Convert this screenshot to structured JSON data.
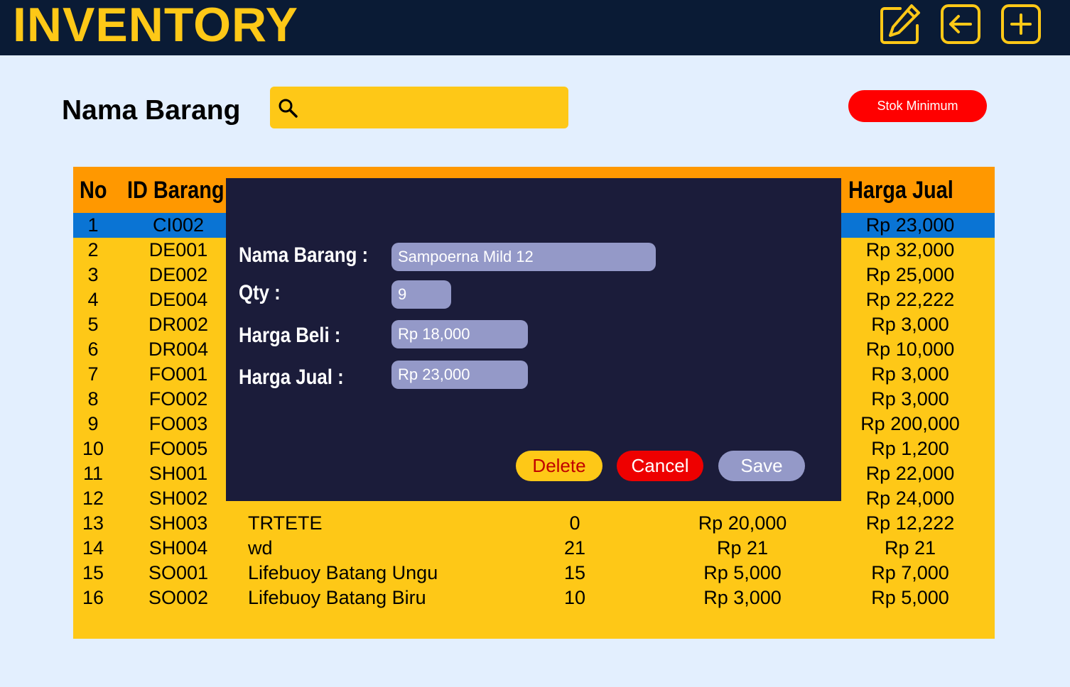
{
  "header": {
    "title": "INVENTORY",
    "edit_icon": "edit-icon",
    "back_icon": "back-arrow-icon",
    "add_icon": "plus-icon"
  },
  "search": {
    "label": "Nama Barang",
    "value": "",
    "icon": "search-icon"
  },
  "stok_minimum_label": "Stok Minimum",
  "colors": {
    "topbar": "#0a1b35",
    "accent_yellow": "#fec817",
    "table_header": "#ff9800",
    "selected_row": "#0a74d4",
    "danger": "#ff0000",
    "modal_bg": "#1b1c3a",
    "modal_input": "#9499c8",
    "page_bg": "#e3effe"
  },
  "table": {
    "headers": {
      "no": "No",
      "id": "ID Barang",
      "jual": "Harga Jual"
    },
    "selected_row": 0,
    "rows": [
      {
        "no": "1",
        "id": "CI002",
        "nama": "",
        "qty": "",
        "beli": "",
        "jual": "Rp 23,000"
      },
      {
        "no": "2",
        "id": "DE001",
        "nama": "",
        "qty": "",
        "beli": "",
        "jual": "Rp 32,000"
      },
      {
        "no": "3",
        "id": "DE002",
        "nama": "",
        "qty": "",
        "beli": "",
        "jual": "Rp 25,000"
      },
      {
        "no": "4",
        "id": "DE004",
        "nama": "",
        "qty": "",
        "beli": "",
        "jual": "Rp 22,222"
      },
      {
        "no": "5",
        "id": "DR002",
        "nama": "",
        "qty": "",
        "beli": "",
        "jual": "Rp 3,000"
      },
      {
        "no": "6",
        "id": "DR004",
        "nama": "",
        "qty": "",
        "beli": "",
        "jual": "Rp 10,000"
      },
      {
        "no": "7",
        "id": "FO001",
        "nama": "",
        "qty": "",
        "beli": "",
        "jual": "Rp 3,000"
      },
      {
        "no": "8",
        "id": "FO002",
        "nama": "",
        "qty": "",
        "beli": "",
        "jual": "Rp 3,000"
      },
      {
        "no": "9",
        "id": "FO003",
        "nama": "",
        "qty": "",
        "beli": "",
        "jual": "Rp 200,000"
      },
      {
        "no": "10",
        "id": "FO005",
        "nama": "",
        "qty": "",
        "beli": "",
        "jual": "Rp 1,200"
      },
      {
        "no": "11",
        "id": "SH001",
        "nama": "",
        "qty": "",
        "beli": "",
        "jual": "Rp 22,000"
      },
      {
        "no": "12",
        "id": "SH002",
        "nama": "",
        "qty": "",
        "beli": "",
        "jual": "Rp 24,000"
      },
      {
        "no": "13",
        "id": "SH003",
        "nama": "TRTETE",
        "qty": "0",
        "beli": "Rp 20,000",
        "jual": "Rp 12,222"
      },
      {
        "no": "14",
        "id": "SH004",
        "nama": "wd",
        "qty": "21",
        "beli": "Rp 21",
        "jual": "Rp 21"
      },
      {
        "no": "15",
        "id": "SO001",
        "nama": "Lifebuoy Batang Ungu",
        "qty": "15",
        "beli": "Rp 5,000",
        "jual": "Rp 7,000"
      },
      {
        "no": "16",
        "id": "SO002",
        "nama": "Lifebuoy Batang Biru",
        "qty": "10",
        "beli": "Rp 3,000",
        "jual": "Rp 5,000"
      }
    ]
  },
  "modal": {
    "nama_label": "Nama Barang :",
    "nama_value": "Sampoerna Mild 12",
    "qty_label": "Qty :",
    "qty_value": "9",
    "beli_label": "Harga Beli :",
    "beli_value": "Rp 18,000",
    "jual_label": "Harga Jual :",
    "jual_value": "Rp 23,000",
    "delete_label": "Delete",
    "cancel_label": "Cancel",
    "save_label": "Save"
  }
}
